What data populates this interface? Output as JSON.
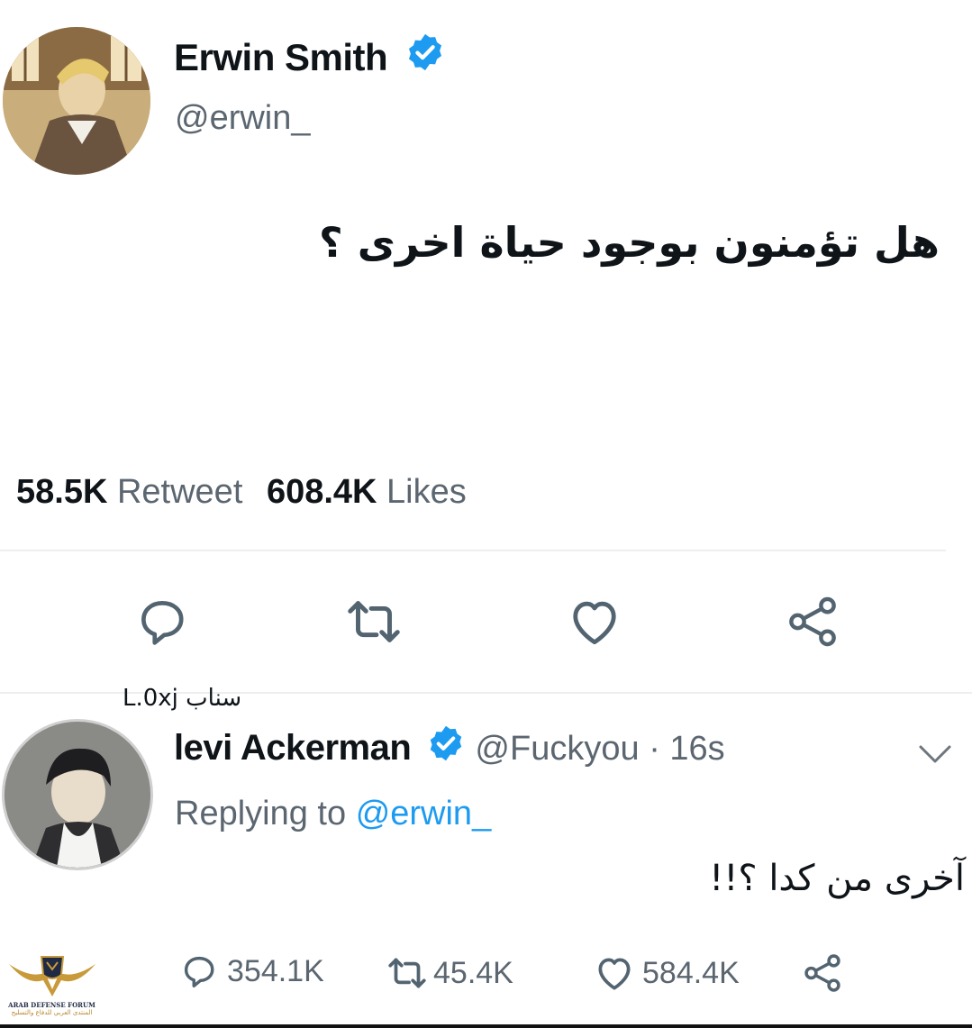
{
  "tweet": {
    "author_name": "Erwin Smith",
    "author_handle": "@erwin_",
    "text": "هل تؤمنون بوجود حياة اخرى ؟",
    "stats": {
      "retweets_count": "58.5K",
      "retweets_label": "Retweet",
      "likes_count": "608.4K",
      "likes_label": "Likes"
    },
    "actions": [
      "reply-icon",
      "retweet-icon",
      "like-icon",
      "share-icon"
    ]
  },
  "watermark_text": "سناب L.0xj",
  "reply": {
    "author_name": "levi Ackerman",
    "author_handle": "@Fuckyou",
    "separator": "·",
    "time": "16s",
    "replying_prefix": "Replying to",
    "replying_handle": "@erwin_",
    "text": "آخرى من كدا ؟!!",
    "metrics": {
      "replies": "354.1K",
      "retweets": "45.4K",
      "likes": "584.4K"
    }
  },
  "forum_logo": {
    "line1": "ARAB DEFENSE FORUM",
    "line2": "المنتدى العربي للدفاع والتسليح"
  },
  "colors": {
    "verified": "#1d9bf0",
    "link": "#1d9bf0",
    "secondary_text": "#5b6670",
    "divider": "#eceef0"
  }
}
